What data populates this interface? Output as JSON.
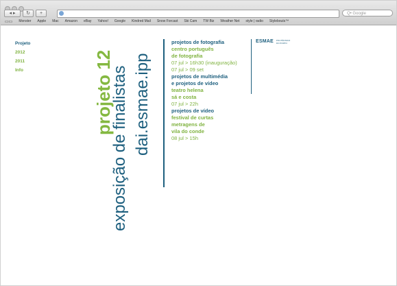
{
  "browser": {
    "search_placeholder": "Q• Google",
    "bookmarks": [
      "Monster",
      "Apple",
      "Mac",
      "Amazon",
      "eBay",
      "Yahoo!",
      "Google",
      "Kindred Mail",
      "Snow Forcast",
      "Ski Cam",
      "TW Biz",
      "Weather Net",
      "style | radio",
      "Stylebouts™"
    ]
  },
  "sidenav": {
    "items": [
      "Projeto",
      "2012",
      "2011",
      "Info"
    ]
  },
  "headline": {
    "title": "projeto 12",
    "subtitle": "exposição de finalistas",
    "url": "dai.esmae.ipp"
  },
  "program": {
    "block1_title": "projetos de fotografia",
    "block1_loc1": "centro português",
    "block1_loc2": "de fotografia",
    "block1_date1": "07 jul > 16h30 (inauguração)",
    "block1_date2": "07 jul > 09 set",
    "block2_title1": "projetos de multimédia",
    "block2_title2": "e projetos de vídeo",
    "block2_loc1": "teatro helena",
    "block2_loc2": "sá e costa",
    "block2_date": "07 jul > 22h",
    "block3_title": "projetos de vídeo",
    "block3_loc1": "festival de curtas",
    "block3_loc2": "metragens de",
    "block3_loc3": "vila do conde",
    "block3_date": "08 jul > 15h"
  },
  "logo": {
    "name": "ESMAE",
    "tag1": "POLITÉCNICO",
    "tag2": "DO PORTO"
  },
  "colors": {
    "green": "#84b841",
    "teal": "#1d5f7e"
  }
}
